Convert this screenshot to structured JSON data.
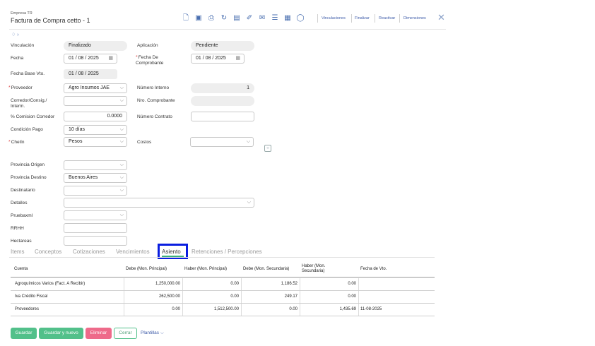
{
  "header": {
    "company": "Empresa TR",
    "title": "Factura de Compra cetto - 1",
    "links": [
      "Vinculaciones",
      "Finalizar",
      "Reactivar",
      "Dimensiones"
    ]
  },
  "form": {
    "vinculacion": {
      "label": "Vinculación",
      "value": "Finalizado"
    },
    "aplicacion": {
      "label": "Aplicación",
      "value": "Pendiente"
    },
    "fecha": {
      "label": "Fecha",
      "value": "01 / 08 / 2025"
    },
    "fecha_comprobante": {
      "label": "Fecha De Comprobante",
      "value": "01 / 08 / 2025"
    },
    "fecha_base_vto": {
      "label": "Fecha Base Vto.",
      "value": "01 / 08 / 2025"
    },
    "proveedor": {
      "label": "Proveedor",
      "value": "Agro Insumos JAE"
    },
    "numero_interno": {
      "label": "Número Interno",
      "value": "1"
    },
    "corredor": {
      "label": "Corredor/Consig./ Interm.",
      "value": ""
    },
    "nro_comprobante": {
      "label": "Nro. Comprobante",
      "value": ""
    },
    "comision": {
      "label": "% Comision Corredor",
      "value": "0.0000"
    },
    "numero_contrato": {
      "label": "Número Contrato",
      "value": ""
    },
    "condicion_pago": {
      "label": "Condición Pago",
      "value": "10 días"
    },
    "chelin": {
      "label": "Chelín",
      "value": "Pesos"
    },
    "costos": {
      "label": "Costos",
      "value": ""
    },
    "provincia_origen": {
      "label": "Provincia Origen",
      "value": ""
    },
    "provincia_destino": {
      "label": "Provincia Destino",
      "value": "Buenos Aires"
    },
    "destinatario": {
      "label": "Destinatario",
      "value": ""
    },
    "detalles": {
      "label": "Detalles",
      "value": ""
    },
    "pruebaxml": {
      "label": "Pruebaxml",
      "value": ""
    },
    "rrhh": {
      "label": "RRHH",
      "value": ""
    },
    "hectareas": {
      "label": "Hectareas",
      "value": ""
    }
  },
  "tabs": [
    "Items",
    "Conceptos",
    "Cotizaciones",
    "Vencimientos",
    "Asiento",
    "Retenciones / Percepciones"
  ],
  "active_tab": "Asiento",
  "table": {
    "headers": [
      "Cuenta",
      "Debe (Mon. Principal)",
      "Haber (Mon. Principal)",
      "Debe (Mon. Secundaria)",
      "Haber (Mon. Secundaria)",
      "Fecha de Vto."
    ],
    "rows": [
      [
        "Agroquímicos Varios (Fact. A Recibir)",
        "1,250,000.00",
        "0.00",
        "1,186.52",
        "0.00",
        ""
      ],
      [
        "Iva Crédito Fiscal",
        "262,500.00",
        "0.00",
        "249.17",
        "0.00",
        ""
      ],
      [
        "Proveedores",
        "0.00",
        "1,512,500.00",
        "0.00",
        "1,435.69",
        "11-08-2025"
      ]
    ]
  },
  "buttons": {
    "guardar": "Guardar",
    "guardar_nuevo": "Guardar y nuevo",
    "eliminar": "Eliminar",
    "cerrar": "Cerrar",
    "plantillas": "Plantillas"
  },
  "colors": {
    "accent_green": "#52c08a",
    "danger_pink": "#ee6a8a",
    "link_blue": "#3c5aa8",
    "highlight_blue": "#0a1ee0"
  }
}
